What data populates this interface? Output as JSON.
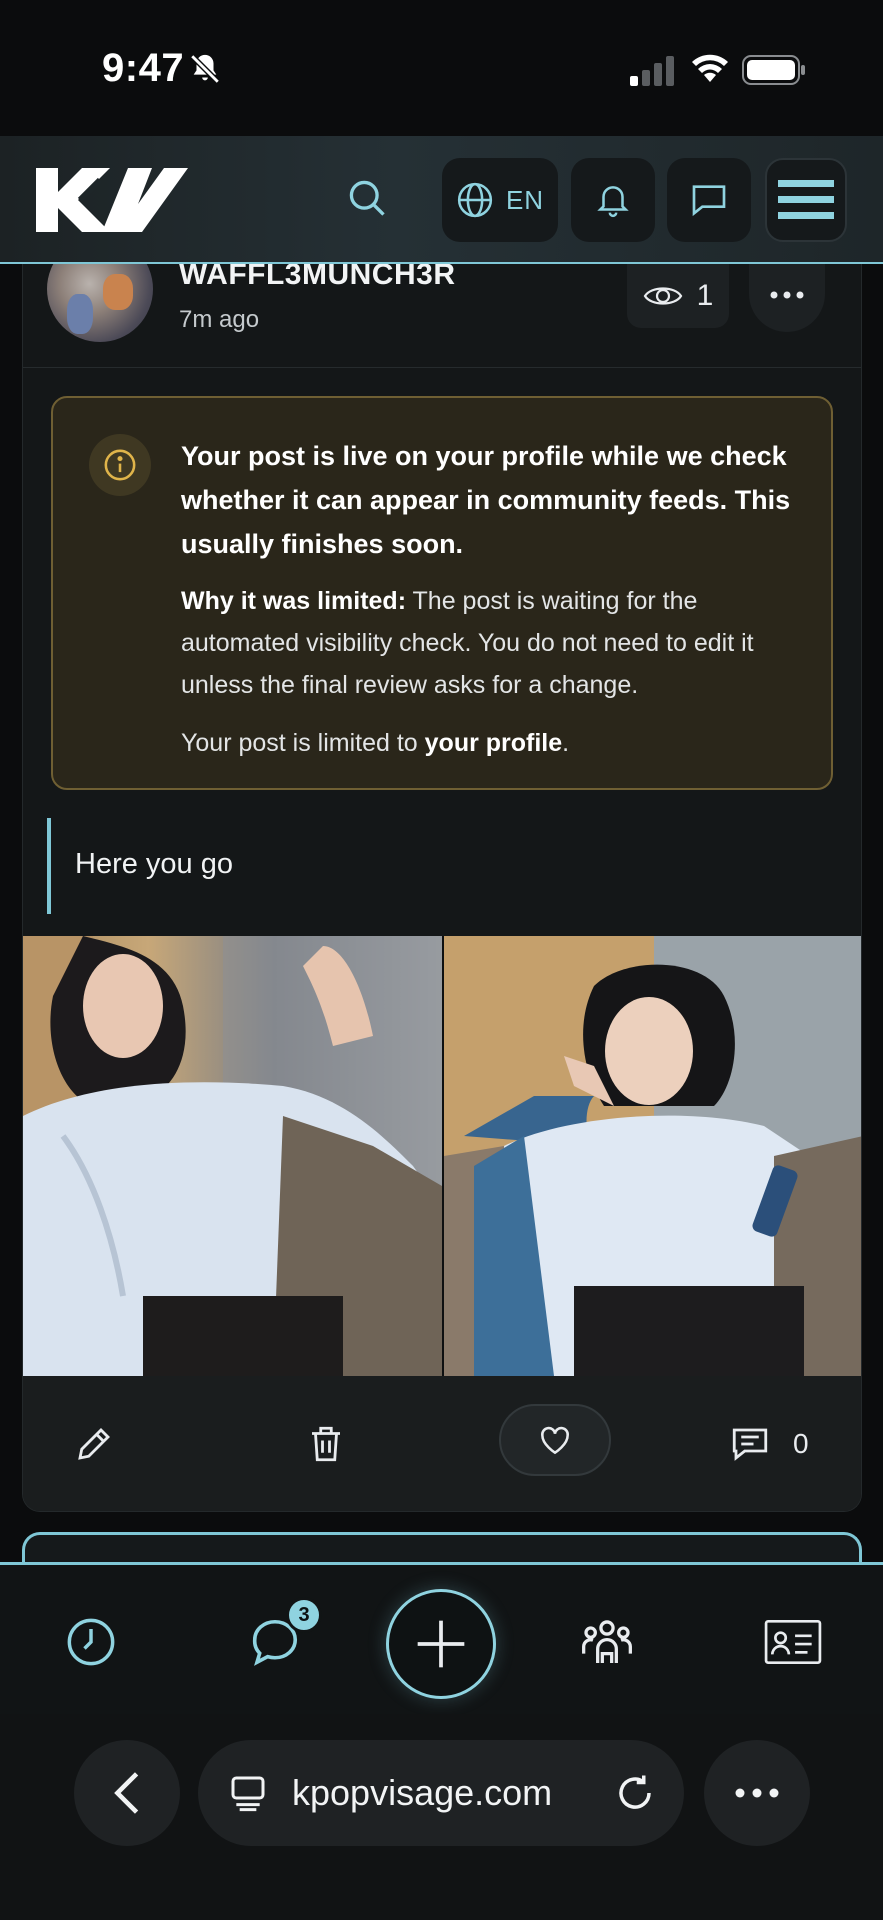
{
  "status_bar": {
    "time": "9:47"
  },
  "header": {
    "logo_text": "KV",
    "language_label": "EN"
  },
  "post": {
    "username": "WAFFL3MUNCH3R",
    "timestamp": "7m ago",
    "view_count": "1",
    "notice": {
      "lead": "Your post is live on your profile while we check whether it can appear in community feeds. This usually finishes soon.",
      "why_label": "Why it was limited:",
      "why_text": " The post is waiting for the automated visibility check. You do not need to edit it unless the final review asks for a change.",
      "limit_prefix": "Your post is limited to ",
      "limit_target": "your profile",
      "limit_suffix": "."
    },
    "body_text": "Here you go",
    "comment_count": "0"
  },
  "bottom_nav": {
    "messages_badge": "3"
  },
  "browser": {
    "url": "kpopvisage.com"
  },
  "colors": {
    "accent": "#7fc7d6",
    "notice_border": "#6f5f33",
    "notice_bg": "#2a261a",
    "notice_icon": "#e0b44a"
  }
}
